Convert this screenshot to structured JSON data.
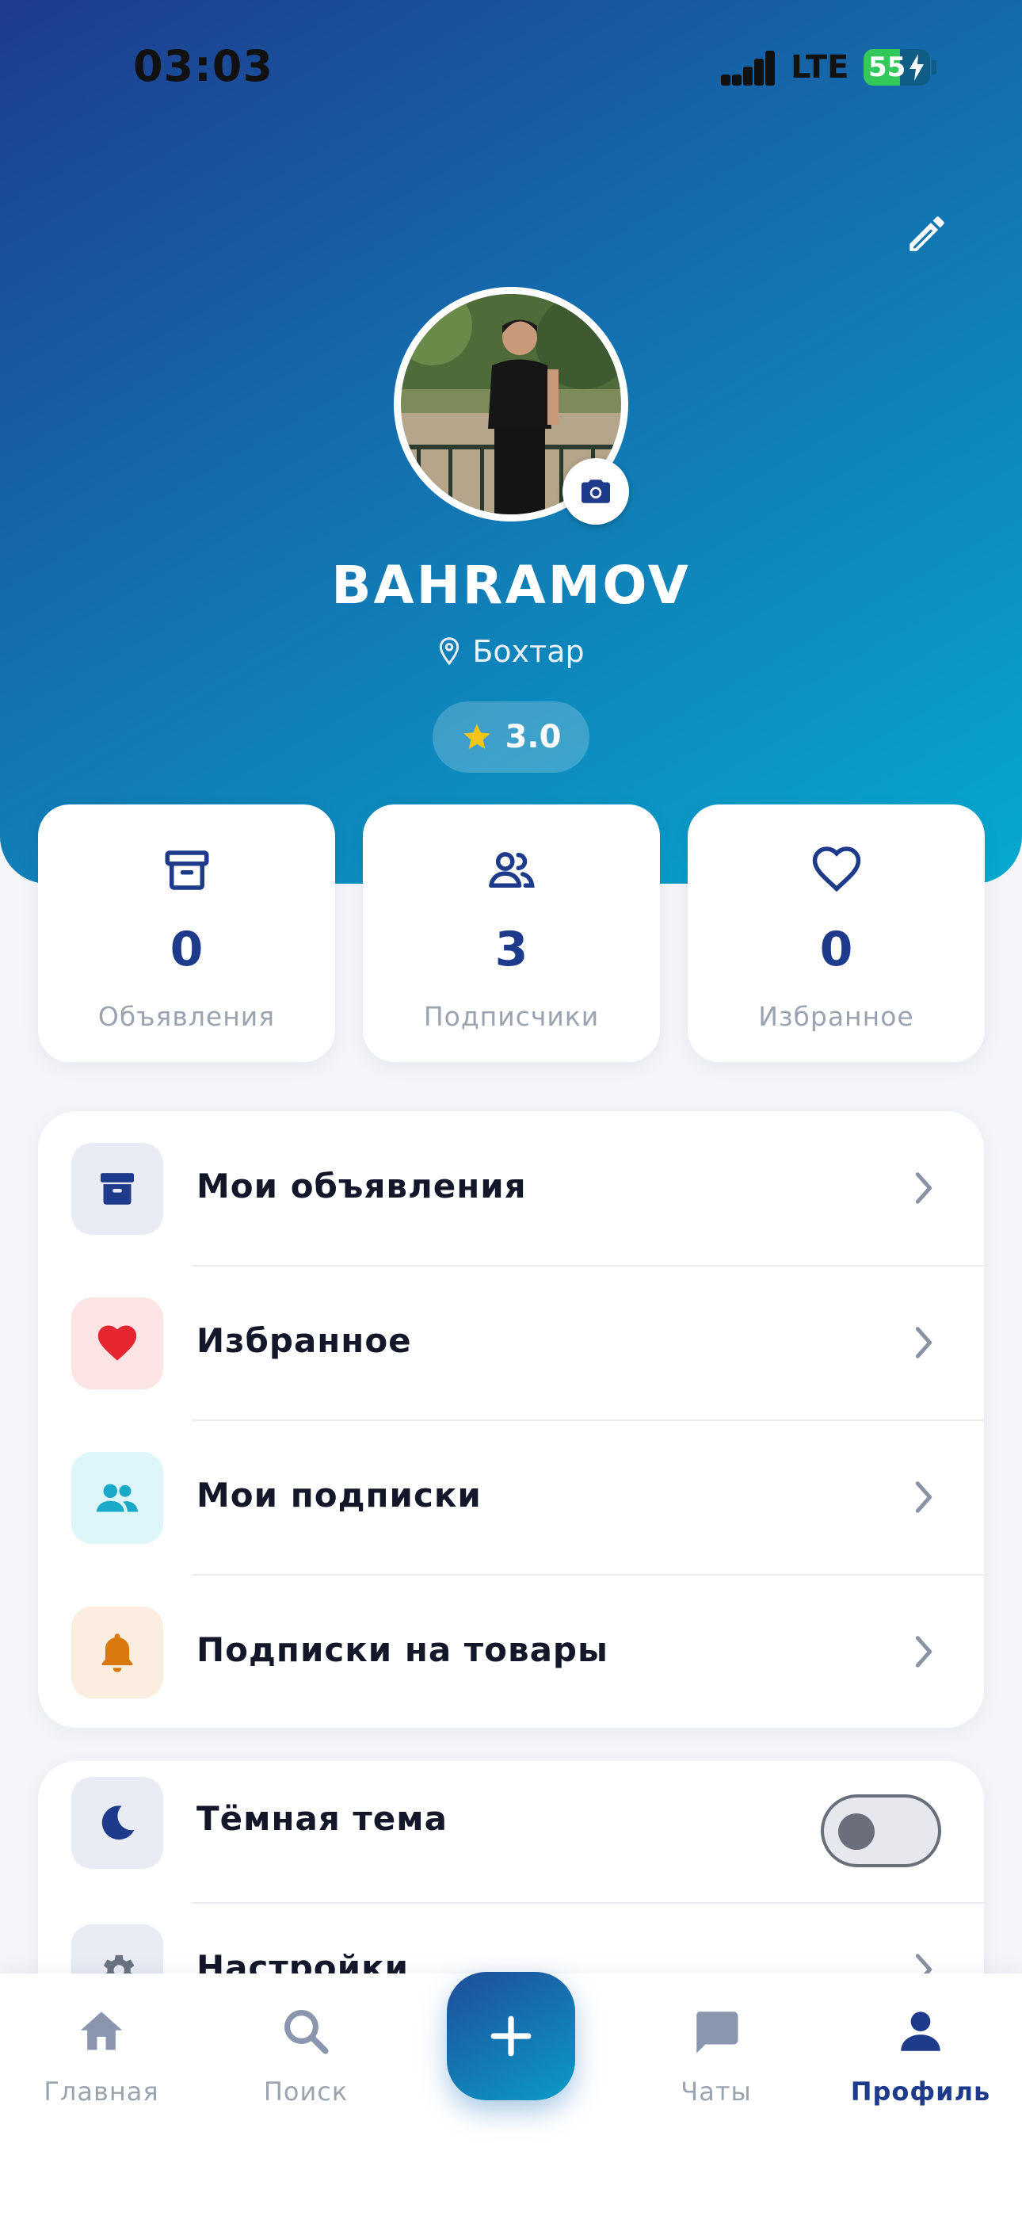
{
  "status_bar": {
    "time": "03:03",
    "network": "LTE",
    "battery": "55"
  },
  "profile": {
    "name": "BAHRAMOV",
    "location": "Бохтар",
    "rating": "3.0"
  },
  "stats": [
    {
      "icon": "archive-icon",
      "value": "0",
      "label": "Объявления"
    },
    {
      "icon": "users-icon",
      "value": "3",
      "label": "Подписчики"
    },
    {
      "icon": "heart-outline-icon",
      "value": "0",
      "label": "Избранное"
    }
  ],
  "menu": [
    {
      "icon": "archive-icon",
      "label": "Мои объявления",
      "icon_bg": "#e9ebf5",
      "icon_color": "#1e3a8a"
    },
    {
      "icon": "heart-icon",
      "label": "Избранное",
      "icon_bg": "#fde4e4",
      "icon_color": "#e3262f"
    },
    {
      "icon": "users-icon",
      "label": "Мои подписки",
      "icon_bg": "#def5fa",
      "icon_color": "#1aa9c8"
    },
    {
      "icon": "bell-icon",
      "label": "Подписки на товары",
      "icon_bg": "#fbeee0",
      "icon_color": "#d9790d"
    }
  ],
  "settings": [
    {
      "icon": "moon-icon",
      "label": "Тёмная тема",
      "toggle_on": false
    },
    {
      "icon": "gear-icon",
      "label": "Настройки"
    }
  ],
  "tabbar": [
    {
      "icon": "home-icon",
      "label": "Главная"
    },
    {
      "icon": "search-icon",
      "label": "Поиск"
    },
    {
      "icon": "chat-icon",
      "label": "Чаты"
    },
    {
      "icon": "person-icon",
      "label": "Профиль",
      "active": true
    }
  ],
  "colors": {
    "accent": "#1e3a8a",
    "gradient_start": "#1d3b8f",
    "gradient_end": "#06aad0"
  }
}
